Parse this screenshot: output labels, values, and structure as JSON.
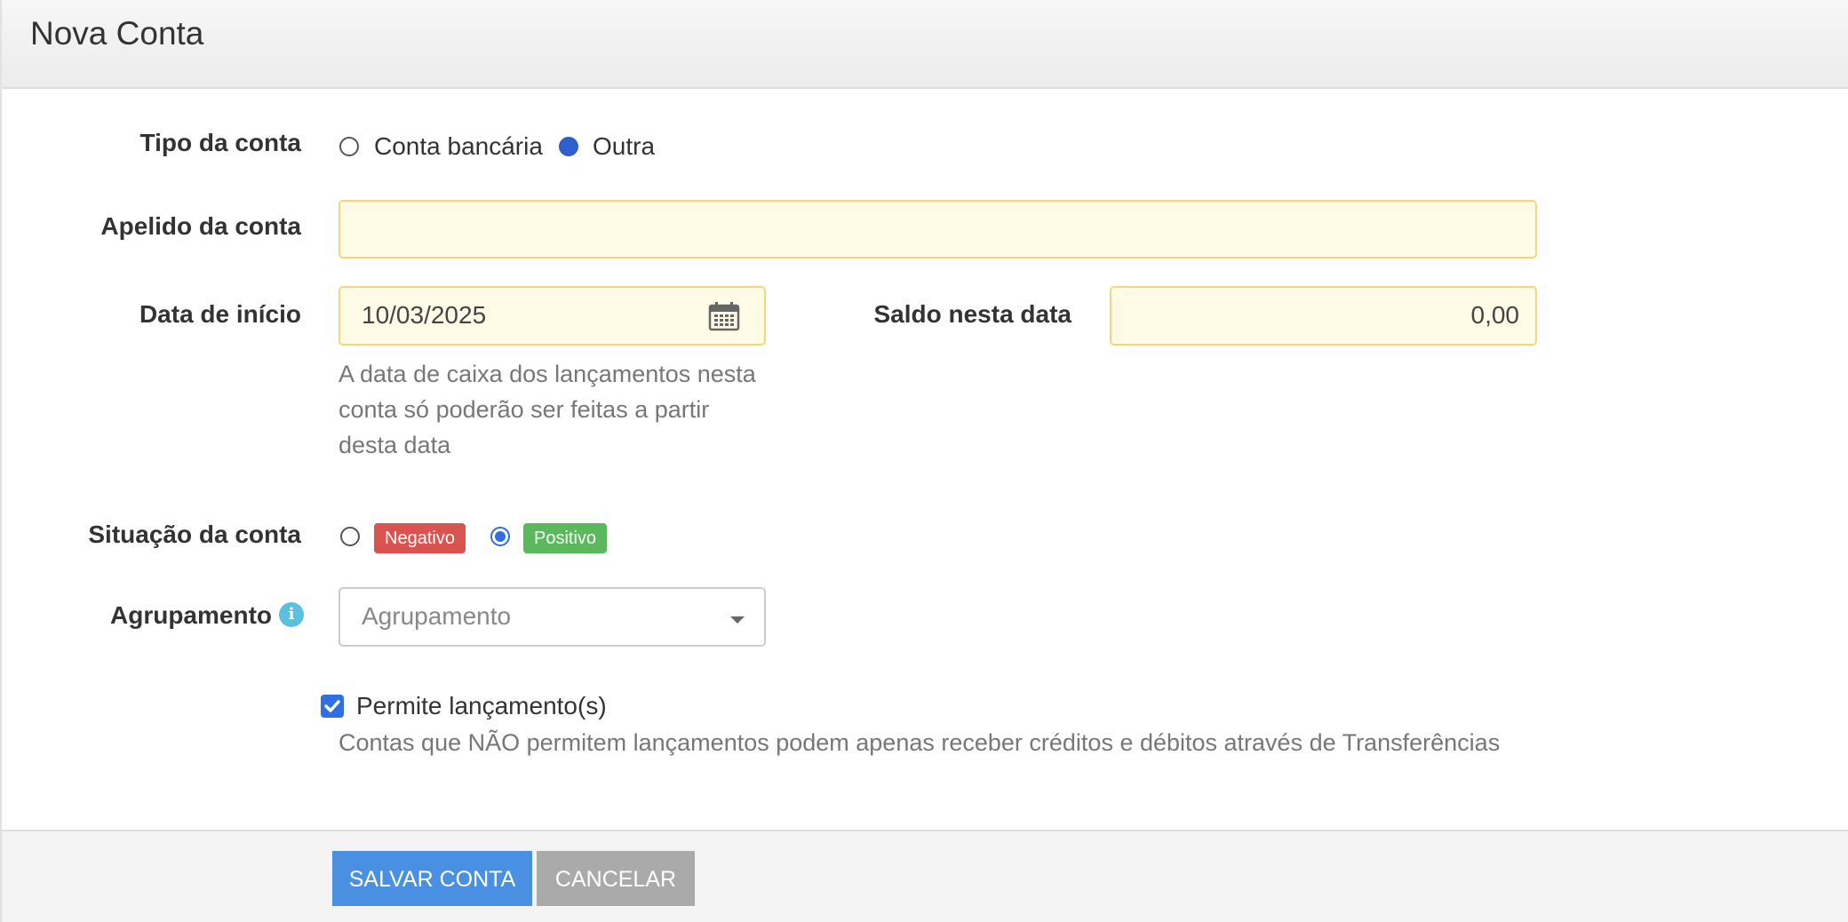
{
  "header": {
    "title": "Nova Conta"
  },
  "form": {
    "tipo": {
      "label": "Tipo da conta",
      "options": [
        "Conta bancária",
        "Outra"
      ],
      "selected": "Outra"
    },
    "apelido": {
      "label": "Apelido da conta",
      "value": ""
    },
    "data_inicio": {
      "label": "Data de início",
      "value": "10/03/2025",
      "help": "A data de caixa dos lançamentos nesta conta só poderão ser feitas a partir desta data"
    },
    "saldo": {
      "label": "Saldo nesta data",
      "value": "0,00"
    },
    "situacao": {
      "label": "Situação da conta",
      "options": [
        "Negativo",
        "Positivo"
      ],
      "selected": "Positivo"
    },
    "agrupamento": {
      "label": "Agrupamento",
      "placeholder": "Agrupamento",
      "info_icon": "info-icon"
    },
    "permite": {
      "label": "Permite lançamento(s)",
      "checked": true,
      "help": "Contas que NÃO permitem lançamentos podem apenas receber créditos e débitos através de Transferências"
    }
  },
  "footer": {
    "save_label": "SALVAR CONTA",
    "cancel_label": "CANCELAR"
  },
  "colors": {
    "negative_badge": "#d9534f",
    "positive_badge": "#5cb85c",
    "primary_button": "#4a90e2",
    "cancel_button": "#aaaaaa",
    "input_bg": "#fffbe6",
    "input_border": "#f3d77a"
  }
}
